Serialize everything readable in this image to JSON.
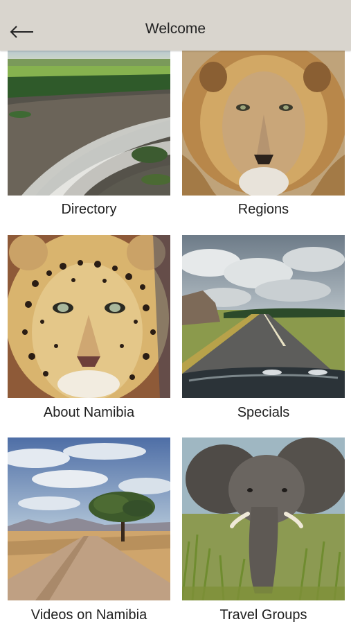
{
  "header": {
    "title": "Welcome",
    "back_icon": "back-arrow-icon",
    "background": "#d9d5ce"
  },
  "tiles": [
    {
      "label": "Directory",
      "image": "river-rapids-aerial"
    },
    {
      "label": "Regions",
      "image": "lion-portrait"
    },
    {
      "label": "About Namibia",
      "image": "leopard-portrait"
    },
    {
      "label": "Specials",
      "image": "open-road-clouds"
    },
    {
      "label": "Videos on Namibia",
      "image": "gravel-road-acacia"
    },
    {
      "label": "Travel Groups",
      "image": "elephant-grass"
    }
  ]
}
